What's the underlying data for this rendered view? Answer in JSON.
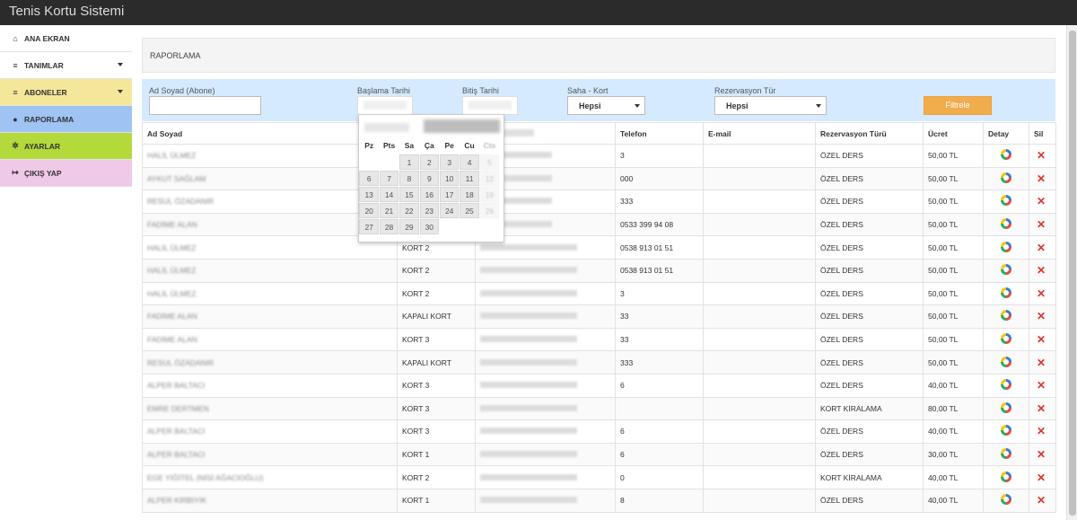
{
  "app": {
    "title": "Tenis Kortu Sistemi"
  },
  "sidebar": {
    "items": [
      {
        "label": "ANA EKRAN",
        "icon": "home-icon",
        "glyph": "⌂",
        "color": "#ffffff",
        "caret": false
      },
      {
        "label": "TANIMLAR",
        "icon": "database-icon",
        "glyph": "≡",
        "color": "#ffffff",
        "caret": true
      },
      {
        "label": "ABONELER",
        "icon": "database-icon",
        "glyph": "≡",
        "color": "#f5e79a",
        "caret": true
      },
      {
        "label": "RAPORLAMA",
        "icon": "map-marker-icon",
        "glyph": "●",
        "color": "#9fc3f3",
        "caret": false
      },
      {
        "label": "AYARLAR",
        "icon": "gear-icon",
        "glyph": "✲",
        "color": "#b3d93b",
        "caret": false
      },
      {
        "label": "ÇIKIŞ YAP",
        "icon": "sign-out-icon",
        "glyph": "↦",
        "color": "#f0c8e8",
        "caret": false
      }
    ]
  },
  "page": {
    "title": "RAPORLAMA"
  },
  "filter": {
    "name_label": "Ad Soyad (Abone)",
    "name_value": "",
    "start_label": "Başlama Tarihi",
    "end_label": "Bitiş Tarihi",
    "court_label": "Saha - Kort",
    "court_value": "Hepsi",
    "type_label": "Rezervasyon Tür",
    "type_value": "Hepsi",
    "button_label": "Filtrele"
  },
  "table": {
    "headers": [
      "Ad Soyad",
      "",
      "",
      "Telefon",
      "E-mail",
      "Rezervasyon Türü",
      "Ücret",
      "Detay",
      "Sil"
    ],
    "rows": [
      {
        "name": "HALİL ÜLMEZ",
        "kort": "",
        "tel": "3",
        "tur": "ÖZEL DERS",
        "ucret": "50,00 TL"
      },
      {
        "name": "AYKUT SAĞLAM",
        "kort": "",
        "tel": "000",
        "tur": "ÖZEL DERS",
        "ucret": "50,00 TL"
      },
      {
        "name": "RESUL ÖZADANIR",
        "kort": "",
        "tel": "333",
        "tur": "ÖZEL DERS",
        "ucret": "50,00 TL"
      },
      {
        "name": "FADİME ALAN",
        "kort": "",
        "tel": "0533 399 94 08",
        "tur": "ÖZEL DERS",
        "ucret": "50,00 TL"
      },
      {
        "name": "HALİL ÜLMEZ",
        "kort": "KORT 2",
        "tel": "0538 913 01 51",
        "tur": "ÖZEL DERS",
        "ucret": "50,00 TL"
      },
      {
        "name": "HALİL ÜLMEZ",
        "kort": "KORT 2",
        "tel": "0538 913 01 51",
        "tur": "ÖZEL DERS",
        "ucret": "50,00 TL"
      },
      {
        "name": "HALİL ÜLMEZ",
        "kort": "KORT 2",
        "tel": "3",
        "tur": "ÖZEL DERS",
        "ucret": "50,00 TL"
      },
      {
        "name": "FADİME ALAN",
        "kort": "KAPALI KORT",
        "tel": "33",
        "tur": "ÖZEL DERS",
        "ucret": "50,00 TL"
      },
      {
        "name": "FADİME ALAN",
        "kort": "KORT 3",
        "tel": "33",
        "tur": "ÖZEL DERS",
        "ucret": "50,00 TL"
      },
      {
        "name": "RESUL ÖZADANIR",
        "kort": "KAPALI KORT",
        "tel": "333",
        "tur": "ÖZEL DERS",
        "ucret": "50,00 TL"
      },
      {
        "name": "ALPER BALTACI",
        "kort": "KORT 3",
        "tel": "6",
        "tur": "ÖZEL DERS",
        "ucret": "40,00 TL"
      },
      {
        "name": "EMRE DERTMEN",
        "kort": "KORT 3",
        "tel": "",
        "tur": "KORT KİRALAMA",
        "ucret": "80,00 TL"
      },
      {
        "name": "ALPER BALTACI",
        "kort": "KORT 3",
        "tel": "6",
        "tur": "ÖZEL DERS",
        "ucret": "40,00 TL"
      },
      {
        "name": "ALPER BALTACI",
        "kort": "KORT 1",
        "tel": "6",
        "tur": "ÖZEL DERS",
        "ucret": "30,00 TL"
      },
      {
        "name": "EGE YİĞİTEL (NİSİ AĞACIOĞLU)",
        "kort": "KORT 2",
        "tel": "0",
        "tur": "KORT KİRALAMA",
        "ucret": "40,00 TL"
      },
      {
        "name": "ALPER KIRBIYIK",
        "kort": "KORT 1",
        "tel": "8",
        "tur": "ÖZEL DERS",
        "ucret": "40,00 TL"
      }
    ]
  },
  "calendar": {
    "day_headers": [
      "Pz",
      "Pts",
      "Sa",
      "Ça",
      "Pe",
      "Cu",
      "Cts"
    ],
    "weeks": [
      [
        "",
        "",
        "1",
        "2",
        "3",
        "4",
        "5"
      ],
      [
        "6",
        "7",
        "8",
        "9",
        "10",
        "11",
        "12"
      ],
      [
        "13",
        "14",
        "15",
        "16",
        "17",
        "18",
        "19"
      ],
      [
        "20",
        "21",
        "22",
        "23",
        "24",
        "25",
        "26"
      ],
      [
        "27",
        "28",
        "29",
        "30",
        "",
        "",
        ""
      ]
    ]
  }
}
